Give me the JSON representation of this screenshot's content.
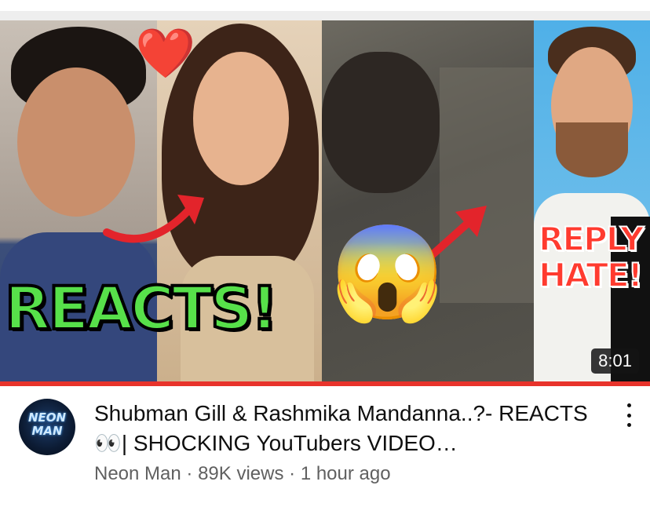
{
  "thumbnail": {
    "overlay_left": "REACTS!",
    "overlay_right_line1": "REPLY",
    "overlay_right_line2": "HATE!",
    "heart_emoji": "❤️",
    "shock_emoji": "😱",
    "duration": "8:01",
    "watch_progress": 1.0
  },
  "channel": {
    "avatar_text_line1": "NEON",
    "avatar_text_line2": "MAN",
    "name": "Neon Man"
  },
  "video": {
    "title": "Shubman Gill & Rashmika Mandanna..?- REACTS 👀| SHOCKING YouTubers VIDEO…",
    "views": "89K views",
    "uploaded": "1 hour ago",
    "separator": "·"
  },
  "colors": {
    "accent_red": "#e8332b",
    "reacts_green": "#57e04a",
    "reply_red": "#ff3b2f",
    "meta_gray": "#606060"
  },
  "icons": [
    "more-vert-icon"
  ]
}
